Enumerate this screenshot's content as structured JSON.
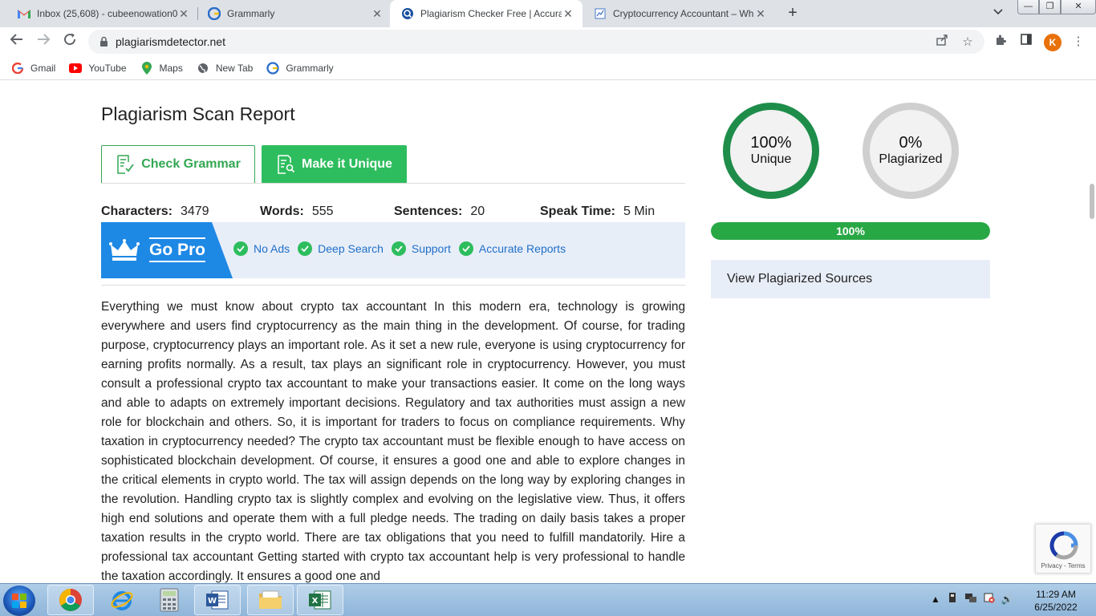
{
  "browser": {
    "tabs": [
      {
        "title": "Inbox (25,608) - cubeenowation0",
        "icon": "gmail-icon",
        "close": "✕"
      },
      {
        "title": "Grammarly",
        "icon": "grammarly-icon",
        "close": "✕"
      },
      {
        "title": "Plagiarism Checker Free | Accurat",
        "icon": "plagiarism-detector-icon",
        "close": "✕"
      },
      {
        "title": "Cryptocurrency Accountant – Wh",
        "icon": "document-icon",
        "close": "✕"
      }
    ],
    "new_tab": "+",
    "url": "plagiarismdetector.net",
    "profile_initial": "K",
    "bookmarks": [
      {
        "label": "Gmail",
        "icon": "google-icon"
      },
      {
        "label": "YouTube",
        "icon": "youtube-icon"
      },
      {
        "label": "Maps",
        "icon": "maps-icon"
      },
      {
        "label": "New Tab",
        "icon": "globe-icon"
      },
      {
        "label": "Grammarly",
        "icon": "grammarly-icon"
      }
    ]
  },
  "report": {
    "title": "Plagiarism Scan Report",
    "check_grammar": "Check Grammar",
    "make_unique": "Make it Unique",
    "stats": {
      "characters_label": "Characters:",
      "characters": "3479",
      "words_label": "Words:",
      "words": "555",
      "sentences_label": "Sentences:",
      "sentences": "20",
      "speak_label": "Speak Time:",
      "speak": "5 Min"
    },
    "gopro": {
      "label": "Go Pro",
      "features": [
        "No Ads",
        "Deep Search",
        "Support",
        "Accurate Reports"
      ]
    },
    "text": "Everything we must know about crypto tax accountant In this modern era, technology is growing everywhere and users find cryptocurrency as the main thing in the development. Of course, for trading purpose, cryptocurrency plays an important role. As it set a new rule, everyone is using cryptocurrency for earning profits normally. As a result, tax plays an significant role in cryptocurrency. However, you must consult a professional crypto tax accountant to make your transactions easier. It come on the long ways and able to adapts on extremely important decisions. Regulatory and tax authorities must assign a new role for blockchain and others. So, it is important for traders to focus on compliance requirements. Why taxation in cryptocurrency needed? The crypto tax accountant must be flexible enough to have access on sophisticated blockchain development. Of course, it ensures a good one and able to explore changes in the critical elements in crypto world. The tax will assign depends on the long way by exploring changes in the revolution. Handling crypto tax is slightly complex and evolving on the legislative view. Thus, it offers high end solutions and operate them with a full pledge needs. The trading on daily basis takes a proper taxation results in the crypto world. There are tax obligations that you need to fulfill mandatorily. Hire a professional tax accountant Getting started with crypto tax accountant help is very professional to handle the taxation accordingly. It ensures a good one and"
  },
  "results": {
    "unique_pct": "100%",
    "unique_label": "Unique",
    "plag_pct": "0%",
    "plag_label": "Plagiarized",
    "progress_value": 100,
    "progress_text": "100%",
    "sources_label": "View Plagiarized Sources",
    "unique_color": "#1e8d4a",
    "plag_color": "#cfcfcf"
  },
  "recaptcha": {
    "text": "Privacy - Terms"
  },
  "taskbar": {
    "apps": [
      "chrome-icon",
      "internet-explorer-icon",
      "calculator-icon",
      "word-icon",
      "file-explorer-icon",
      "excel-icon"
    ],
    "time": "11:29 AM",
    "date": "6/25/2022"
  }
}
